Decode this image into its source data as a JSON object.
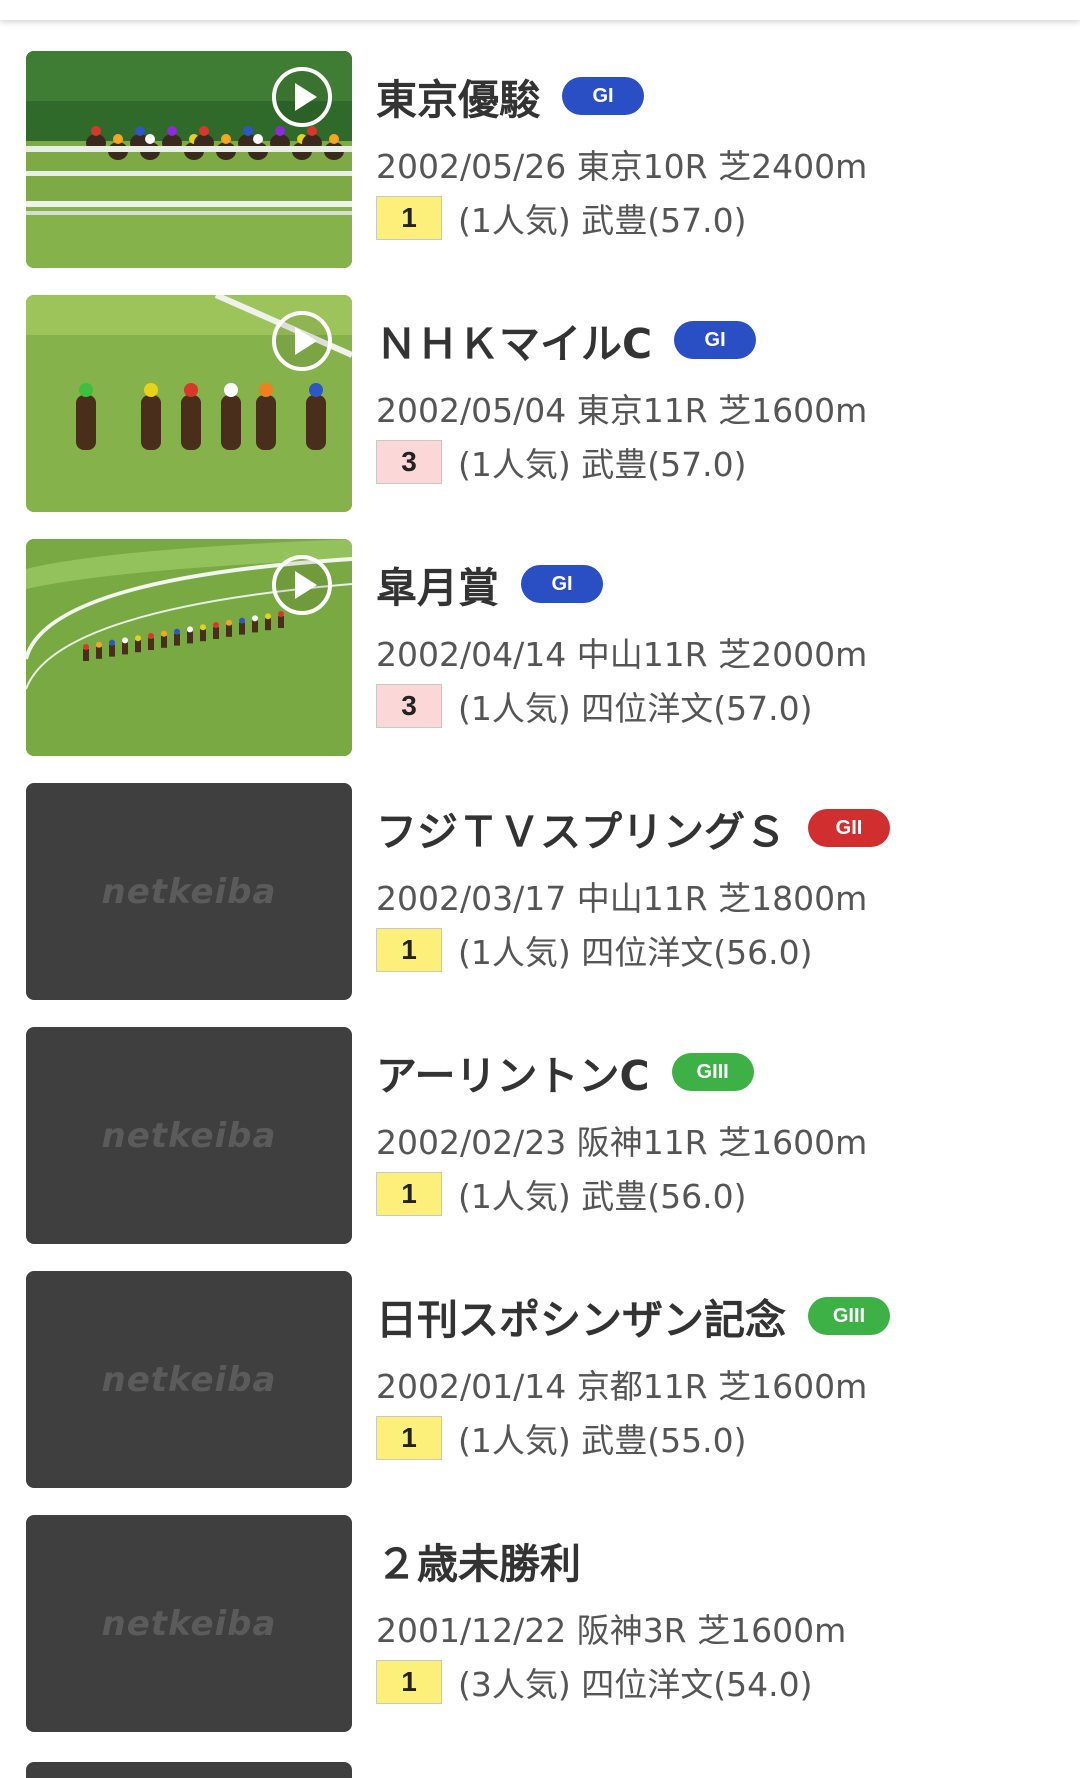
{
  "brand_placeholder": "netkeiba",
  "colors": {
    "G1": "#2a4fc4",
    "G2": "#d12f2f",
    "G3": "#3db146",
    "rank_first": "#fdf07a",
    "rank_other": "#fcd7d7"
  },
  "races": [
    {
      "name": "東京優駿",
      "grade": "GI",
      "grade_class": "G1",
      "meta": "2002/05/26 東京10R 芝2400m",
      "rank": "1",
      "rank_type": "rank_first",
      "result": "(1人気) 武豊(57.0)",
      "thumb": "video",
      "thumb_scene": "stretch"
    },
    {
      "name": "ＮＨＫマイルC",
      "grade": "GI",
      "grade_class": "G1",
      "meta": "2002/05/04 東京11R 芝1600m",
      "rank": "3",
      "rank_type": "rank_other",
      "result": "(1人気) 武豊(57.0)",
      "thumb": "video",
      "thumb_scene": "front"
    },
    {
      "name": "皐月賞",
      "grade": "GI",
      "grade_class": "G1",
      "meta": "2002/04/14 中山11R 芝2000m",
      "rank": "3",
      "rank_type": "rank_other",
      "result": "(1人気) 四位洋文(57.0)",
      "thumb": "video",
      "thumb_scene": "aerial"
    },
    {
      "name": "フジＴＶスプリングＳ",
      "grade": "GII",
      "grade_class": "G2",
      "meta": "2002/03/17 中山11R 芝1800m",
      "rank": "1",
      "rank_type": "rank_first",
      "result": "(1人気) 四位洋文(56.0)",
      "thumb": "placeholder"
    },
    {
      "name": "アーリントンC",
      "grade": "GIII",
      "grade_class": "G3",
      "meta": "2002/02/23 阪神11R 芝1600m",
      "rank": "1",
      "rank_type": "rank_first",
      "result": "(1人気) 武豊(56.0)",
      "thumb": "placeholder"
    },
    {
      "name": "日刊スポシンザン記念",
      "grade": "GIII",
      "grade_class": "G3",
      "meta": "2002/01/14 京都11R 芝1600m",
      "rank": "1",
      "rank_type": "rank_first",
      "result": "(1人気) 武豊(55.0)",
      "thumb": "placeholder"
    },
    {
      "name": "２歳未勝利",
      "grade": "",
      "grade_class": "",
      "meta": "2001/12/22 阪神3R 芝1600m",
      "rank": "1",
      "rank_type": "rank_first",
      "result": "(3人気) 四位洋文(54.0)",
      "thumb": "placeholder"
    }
  ]
}
